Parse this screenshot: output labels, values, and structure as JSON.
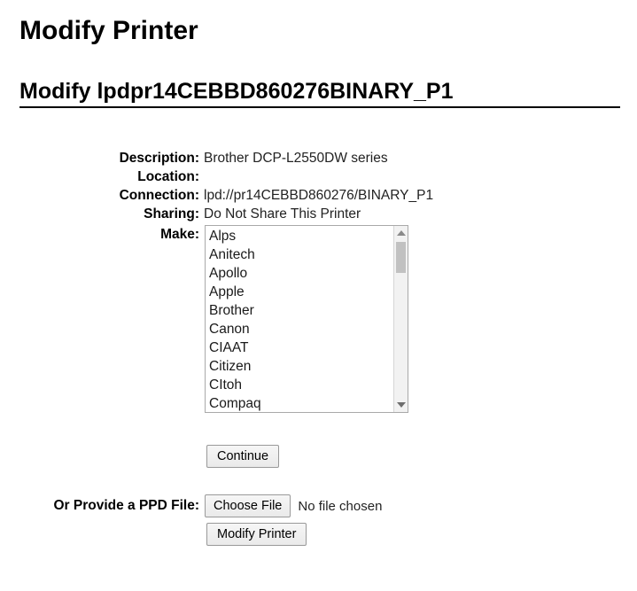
{
  "page": {
    "h1_title": "Modify Printer",
    "h2_title": "Modify lpdpr14CEBBD860276BINARY_P1"
  },
  "attributes": [
    {
      "label": "Description:",
      "value": "Brother DCP-L2550DW series"
    },
    {
      "label": "Location:",
      "value": ""
    },
    {
      "label": "Connection:",
      "value": "lpd://pr14CEBBD860276/BINARY_P1"
    },
    {
      "label": "Sharing:",
      "value": "Do Not Share This Printer"
    }
  ],
  "make": {
    "label": "Make:",
    "options": [
      "Alps",
      "Anitech",
      "Apollo",
      "Apple",
      "Brother",
      "Canon",
      "CIAAT",
      "Citizen",
      "CItoh",
      "Compaq"
    ],
    "selected": "Alps"
  },
  "buttons": {
    "continue": "Continue",
    "modify_printer": "Modify Printer",
    "choose_file": "Choose File"
  },
  "ppd": {
    "label": "Or Provide a PPD File:",
    "file_status": "No file chosen"
  },
  "colors": {
    "text": "#000000",
    "value_text": "#222222",
    "border": "#a9a9a9",
    "button_face": "#eaeaea",
    "scrollbar_track": "#f2f2f2",
    "scrollbar_thumb": "#c1c1c1"
  }
}
